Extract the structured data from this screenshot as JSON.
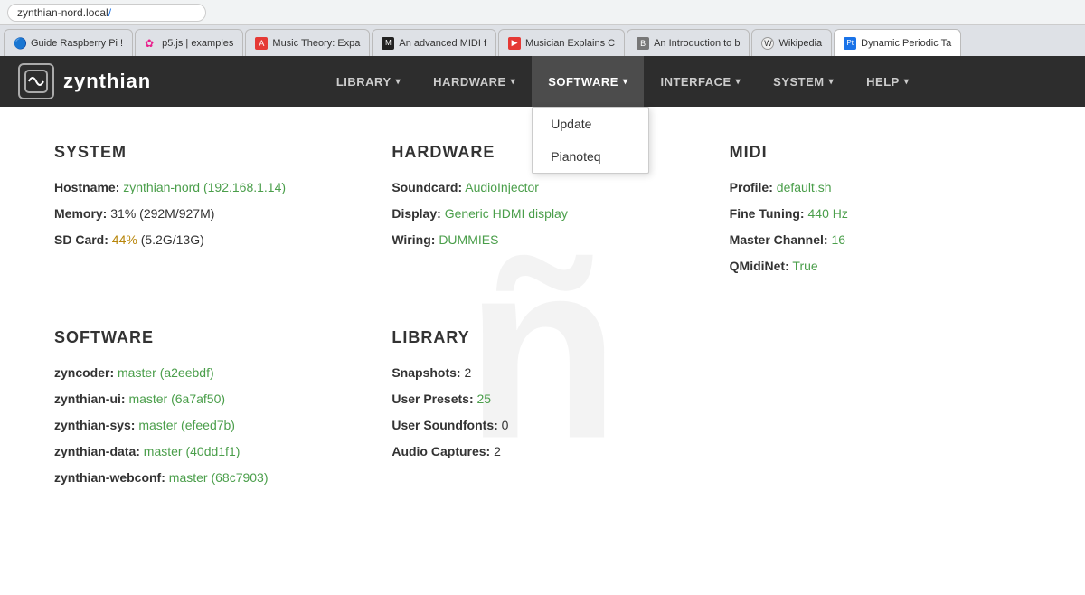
{
  "browser": {
    "url": "zynthian-nord.local/",
    "url_plain": "zynthian-nord.local",
    "url_suffix": "/"
  },
  "tabs": [
    {
      "id": "tab-guide",
      "favicon_color": "#4285f4",
      "favicon_char": "🔵",
      "label": "Guide Raspberry Pi !",
      "active": false,
      "favicon_type": "circle-blue"
    },
    {
      "id": "tab-p5js",
      "favicon_color": "#e91e8c",
      "favicon_char": "✿",
      "label": "p5.js | examples",
      "active": false,
      "favicon_type": "flower"
    },
    {
      "id": "tab-music",
      "favicon_color": "#e53935",
      "favicon_char": "A",
      "label": "Music Theory: Expa",
      "active": false,
      "favicon_type": "a-red"
    },
    {
      "id": "tab-midi",
      "favicon_color": "#222",
      "favicon_char": "M",
      "label": "An advanced MIDI f",
      "active": false,
      "favicon_type": "dark"
    },
    {
      "id": "tab-musician",
      "favicon_color": "#e53935",
      "favicon_char": "▶",
      "label": "Musician Explains C",
      "active": false,
      "favicon_type": "youtube"
    },
    {
      "id": "tab-intro",
      "favicon_color": "#555",
      "favicon_char": "B",
      "label": "An Introduction to b",
      "active": false,
      "favicon_type": "book"
    },
    {
      "id": "tab-wikipedia",
      "favicon_color": "#555",
      "favicon_char": "W",
      "label": "Wikipedia",
      "active": false,
      "favicon_type": "wikipedia"
    },
    {
      "id": "tab-dynamic",
      "favicon_color": "#1a73e8",
      "favicon_char": "Pt",
      "label": "Dynamic Periodic Ta",
      "active": false,
      "favicon_type": "pt"
    }
  ],
  "navbar": {
    "logo_text": "zynthian",
    "items": [
      {
        "id": "nav-library",
        "label": "LIBRARY",
        "has_dropdown": true
      },
      {
        "id": "nav-hardware",
        "label": "HARDWARE",
        "has_dropdown": true
      },
      {
        "id": "nav-software",
        "label": "SOFTWARE",
        "has_dropdown": true,
        "active": true
      },
      {
        "id": "nav-interface",
        "label": "INTERFACE",
        "has_dropdown": true
      },
      {
        "id": "nav-system",
        "label": "SYSTEM",
        "has_dropdown": true
      },
      {
        "id": "nav-help",
        "label": "HELP",
        "has_dropdown": true
      }
    ],
    "software_dropdown": [
      {
        "id": "dd-update",
        "label": "Update"
      },
      {
        "id": "dd-pianoteq",
        "label": "Pianoteq"
      }
    ]
  },
  "sections": {
    "system": {
      "title": "SYSTEM",
      "hostname_label": "Hostname:",
      "hostname_value": "zynthian-nord (192.168.1.14)",
      "hostname_suffix": "",
      "memory_label": "Memory:",
      "memory_value": "31% (292M/927M)",
      "sdcard_label": "SD Card:",
      "sdcard_pct": "44%",
      "sdcard_detail": "(5.2G/13G)"
    },
    "hardware": {
      "title": "HARDWARE",
      "soundcard_label": "Soundcard:",
      "soundcard_value": "AudioInjector",
      "display_label": "Display:",
      "display_value": "Generic HDMI display",
      "wiring_label": "Wiring:",
      "wiring_value": "DUMMIES"
    },
    "midi": {
      "title": "MIDI",
      "profile_label": "Profile:",
      "profile_value": "default.sh",
      "finetuning_label": "Fine Tuning:",
      "finetuning_value": "440 Hz",
      "masterchannel_label": "Master Channel:",
      "masterchannel_value": "16",
      "qmidinet_label": "QMidiNet:",
      "qmidinet_value": "True"
    },
    "software": {
      "title": "SOFTWARE",
      "zyncoder_label": "zyncoder:",
      "zyncoder_value": "master (a2eebdf)",
      "zynthian_ui_label": "zynthian-ui:",
      "zynthian_ui_value": "master (6a7af50)",
      "zynthian_sys_label": "zynthian-sys:",
      "zynthian_sys_value": "master (efeed7b)",
      "zynthian_data_label": "zynthian-data:",
      "zynthian_data_value": "master (40dd1f1)",
      "zynthian_webconf_label": "zynthian-webconf:",
      "zynthian_webconf_value": "master (68c7903)"
    },
    "library": {
      "title": "LIBRARY",
      "snapshots_label": "Snapshots:",
      "snapshots_value": "2",
      "user_presets_label": "User Presets:",
      "user_presets_value": "25",
      "user_soundfonts_label": "User Soundfonts:",
      "user_soundfonts_value": "0",
      "audio_captures_label": "Audio Captures:",
      "audio_captures_value": "2"
    }
  },
  "watermark_text": "ñ"
}
